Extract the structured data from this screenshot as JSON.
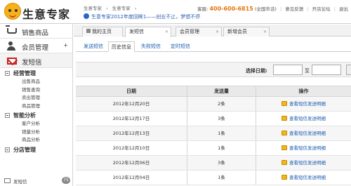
{
  "app": {
    "name": "生意专家"
  },
  "breadcrumb": [
    "生意专家",
    "生意专家"
  ],
  "notice": "生意专家2012年度回眸1——创业不止，梦想不停",
  "toplinks": {
    "hotline_label": "客服:",
    "phone": "400-600-6815",
    "region": "(全国市话)",
    "links": [
      "意见反馈",
      "开店论坛",
      "退出"
    ]
  },
  "sidebar": {
    "main": [
      {
        "label": "销售商品",
        "icon": "cart-icon"
      },
      {
        "label": "会员管理",
        "icon": "users-icon",
        "extra": "+"
      },
      {
        "label": "发短信",
        "icon": "mail-icon"
      }
    ],
    "groups": [
      {
        "label": "经营管理",
        "items": [
          "出售商品",
          "销售查询",
          "卖出管理",
          "商品管理"
        ]
      },
      {
        "label": "智能分析",
        "items": [
          "客户分析",
          "销量分析",
          "商品分析"
        ]
      },
      {
        "label": "分店管理",
        "items": []
      }
    ],
    "messages": {
      "label": "发短信",
      "count": "75"
    }
  },
  "tabs": [
    {
      "label": "我的主页"
    },
    {
      "label": "发短信",
      "active": true
    },
    {
      "label": "会员管理"
    },
    {
      "label": "新增会员"
    }
  ],
  "subtabs": [
    "发送短信",
    "历史信息",
    "失败短信",
    "定时短信"
  ],
  "filter": {
    "label": "选择日期:",
    "to": "至"
  },
  "table": {
    "headers": [
      "日期",
      "发送量",
      "操作"
    ],
    "rows": [
      {
        "date": "2012年12月20日",
        "count": "2条",
        "action": "查看短信发送明细"
      },
      {
        "date": "2012年12月17日",
        "count": "3条",
        "action": "查看短信发送明细"
      },
      {
        "date": "2012年12月13日",
        "count": "1条",
        "action": "查看短信发送明细"
      },
      {
        "date": "2012年12月10日",
        "count": "1条",
        "action": "查看短信发送明细"
      },
      {
        "date": "2012年12月06日",
        "count": "3条",
        "action": "查看短信发送明细"
      },
      {
        "date": "2012年12月04日",
        "count": "1条",
        "action": "查看短信发送明细"
      }
    ]
  }
}
